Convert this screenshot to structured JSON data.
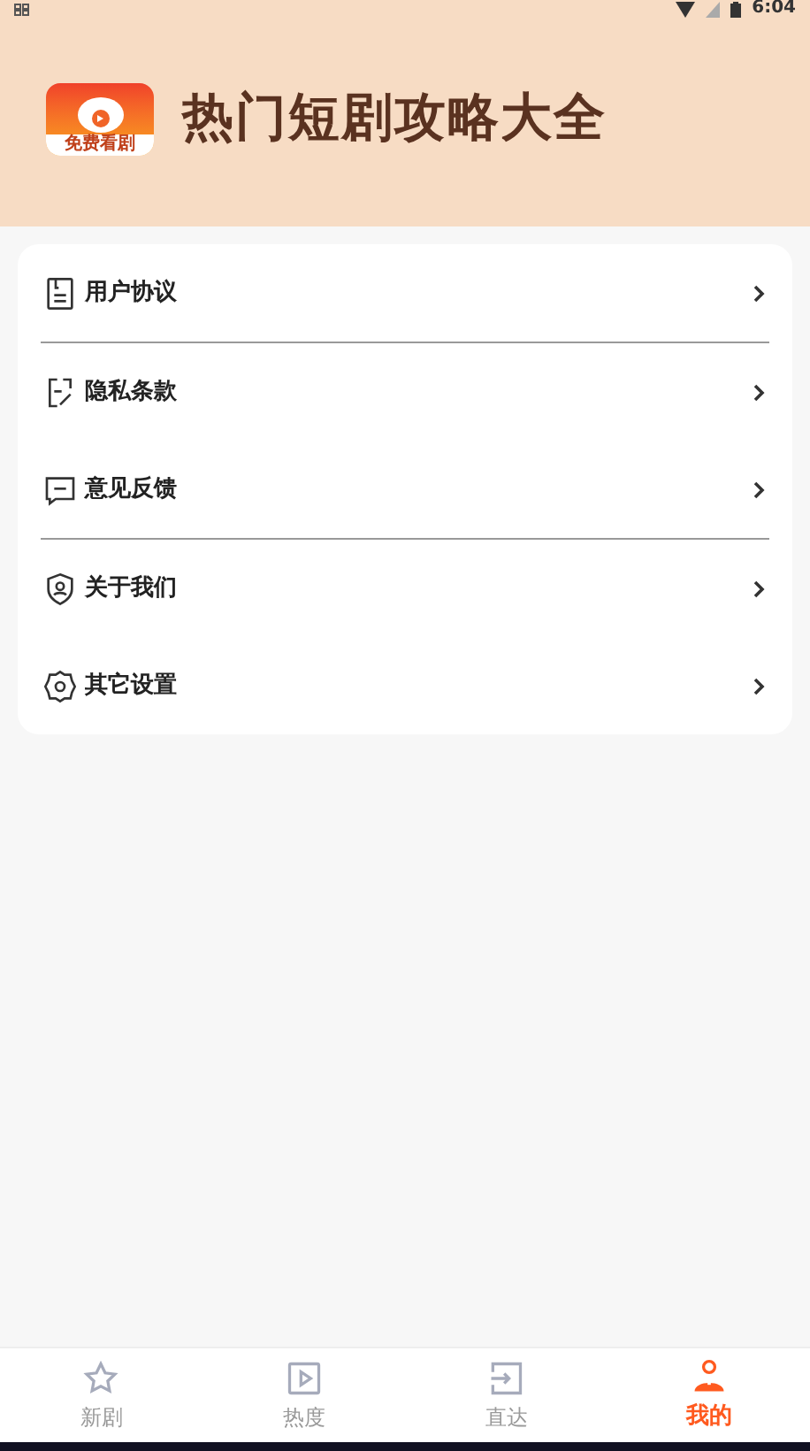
{
  "status_bar": {
    "time": "6:04"
  },
  "header": {
    "logo_caption": "免费看剧",
    "title": "热门短剧攻略大全"
  },
  "menu": [
    {
      "kind": "document",
      "label": "用户协议",
      "divider": true
    },
    {
      "kind": "edit",
      "label": "隐私条款",
      "divider": false
    },
    {
      "kind": "message",
      "label": "意见反馈",
      "divider": true
    },
    {
      "kind": "shield",
      "label": "关于我们",
      "divider": false
    },
    {
      "kind": "gear",
      "label": "其它设置",
      "divider": false
    }
  ],
  "tabs": [
    {
      "kind": "star",
      "label": "新剧",
      "selected": false
    },
    {
      "kind": "play",
      "label": "热度",
      "selected": false
    },
    {
      "kind": "enter",
      "label": "直达",
      "selected": false
    },
    {
      "kind": "user",
      "label": "我的",
      "selected": true
    }
  ]
}
